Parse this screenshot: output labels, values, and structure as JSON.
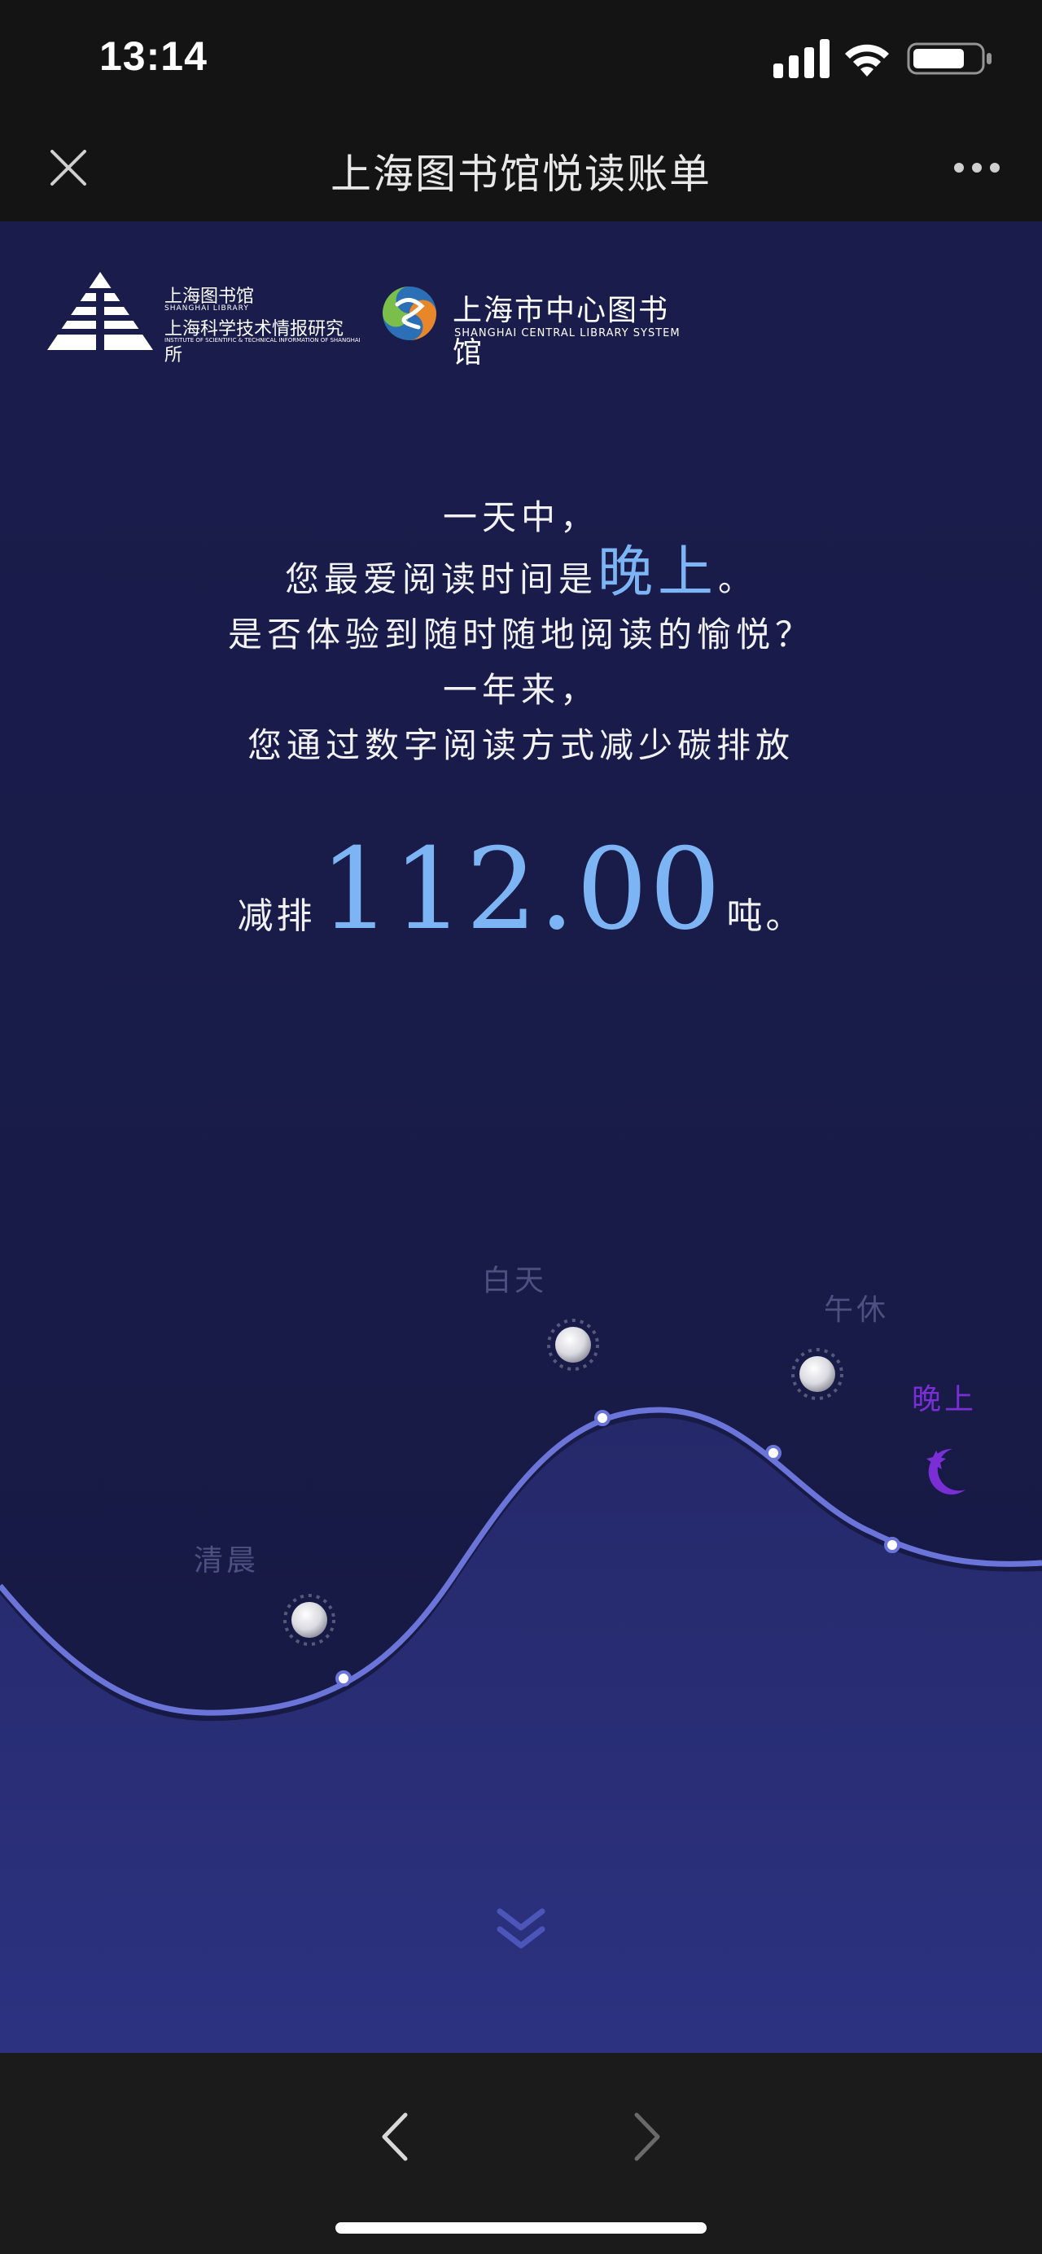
{
  "status_bar": {
    "time": "13:14"
  },
  "nav": {
    "title": "上海图书馆悦读账单"
  },
  "logos": {
    "shanghai_library_cn": "上海图书馆",
    "shanghai_library_en": "SHANGHAI LIBRARY",
    "istis_cn": "上海科学技术情报研究所",
    "istis_en": "INSTITUTE OF SCIENTIFIC & TECHNICAL INFORMATION OF SHANGHAI",
    "central_cn": "上海市中心图书馆",
    "central_en": "SHANGHAI CENTRAL LIBRARY SYSTEM"
  },
  "content": {
    "line1": "一天中，",
    "line2_prefix": "您最爱阅读时间是",
    "line2_highlight": "晚上",
    "line2_suffix": "。",
    "line3": "是否体验到随时随地阅读的愉悦？",
    "line4": "一年来，",
    "line5": "您通过数字阅读方式减少碳排放",
    "emission_prefix": "减排",
    "emission_value": "112.00",
    "emission_suffix": "吨。"
  },
  "time_labels": {
    "morning": "清晨",
    "daytime": "白天",
    "noon_break": "午休",
    "night": "晚上"
  },
  "colors": {
    "background": "#1a1d4c",
    "highlight": "#7db4f3",
    "night_accent": "#7a2fd6",
    "label_dim": "#4d5080"
  },
  "icons": {
    "close": "close-icon",
    "more": "more-icon",
    "sun": "sun-icon",
    "moon": "moon-icon",
    "scroll_down": "chevron-double-down-icon",
    "back": "chevron-left-icon",
    "forward": "chevron-right-icon"
  }
}
